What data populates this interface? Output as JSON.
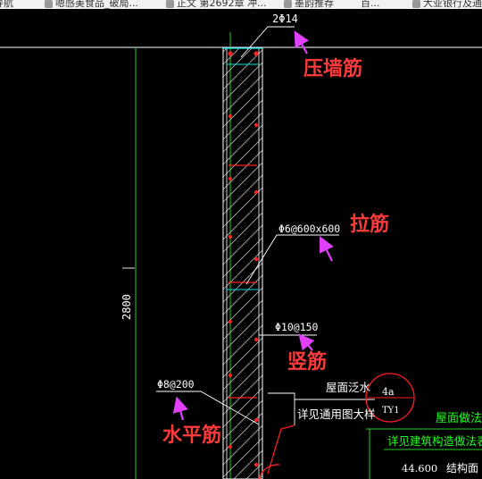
{
  "browser_tabs": [
    {
      "label": "网导航"
    },
    {
      "label": "嗯感美食品_破局..."
    },
    {
      "label": "正文 第2692章 冲..."
    },
    {
      "label": "墨韵推荐"
    },
    {
      "label": "百..."
    },
    {
      "label": "大亚银行及通..."
    }
  ],
  "drawing": {
    "callouts": {
      "top_bar": "2Φ14",
      "tie_bar": "Φ6@600x600",
      "vertical_bar": "Φ10@150",
      "horizontal_bar": "Φ8@200"
    },
    "dimension": "2800",
    "notes": {
      "roof_flashing": "屋面泛水",
      "see_detail": "详见通用图大样",
      "ref_number": "4a",
      "ref_sheet": "TY1",
      "roof_method_title": "屋面做法",
      "roof_method_ref": "详见建筑构造做法表",
      "elevation": "44.600",
      "structure_surface": "结构面"
    },
    "annotations": {
      "pressure_wall_bar": "压墙筋",
      "tie_bar": "拉筋",
      "vertical_bar": "竖筋",
      "horizontal_bar": "水平筋"
    },
    "colors": {
      "background": "#000000",
      "annotation": "#ff3a3a",
      "arrow": "#e040fb",
      "green_line": "#22cc22",
      "cyan": "#00e5e5",
      "rebar_red": "#ff2020"
    }
  }
}
